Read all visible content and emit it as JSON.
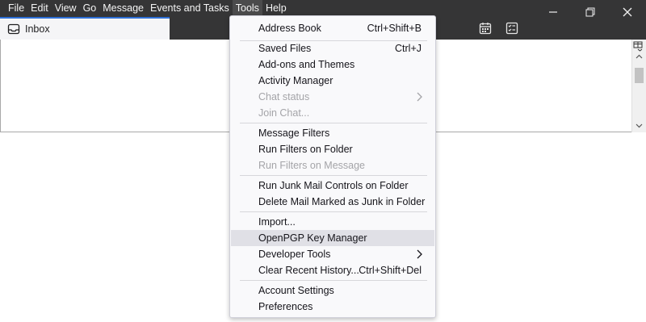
{
  "menubar": {
    "items": [
      {
        "label": "File"
      },
      {
        "label": "Edit"
      },
      {
        "label": "View"
      },
      {
        "label": "Go"
      },
      {
        "label": "Message"
      },
      {
        "label": "Events and Tasks"
      },
      {
        "label": "Tools"
      },
      {
        "label": "Help"
      }
    ]
  },
  "tab": {
    "label": "Inbox"
  },
  "tools_menu": {
    "items": [
      {
        "label": "Address Book",
        "shortcut": "Ctrl+Shift+B"
      },
      {
        "label": "Saved Files",
        "shortcut": "Ctrl+J"
      },
      {
        "label": "Add-ons and Themes"
      },
      {
        "label": "Activity Manager"
      },
      {
        "label": "Chat status",
        "disabled": true
      },
      {
        "label": "Join Chat...",
        "disabled": true
      },
      {
        "label": "Message Filters"
      },
      {
        "label": "Run Filters on Folder"
      },
      {
        "label": "Run Filters on Message",
        "disabled": true
      },
      {
        "label": "Run Junk Mail Controls on Folder"
      },
      {
        "label": "Delete Mail Marked as Junk in Folder"
      },
      {
        "label": "Import..."
      },
      {
        "label": "OpenPGP Key Manager",
        "highlighted": true
      },
      {
        "label": "Developer Tools"
      },
      {
        "label": "Clear Recent History...",
        "shortcut": "Ctrl+Shift+Del"
      },
      {
        "label": "Account Settings"
      },
      {
        "label": "Preferences"
      }
    ]
  },
  "icons": {
    "tab": "inbox-icon",
    "calendar": "calendar-icon",
    "tasks": "tasks-icon",
    "column_picker": "column-picker-icon",
    "minimize": "minimize-icon",
    "maximize": "restore-icon",
    "close": "close-icon"
  },
  "colors": {
    "titlebar": "#353536",
    "tab_accent": "#2e6fd6",
    "menu_bg": "#f9f9fb",
    "menu_highlight": "#e0e0e6"
  }
}
